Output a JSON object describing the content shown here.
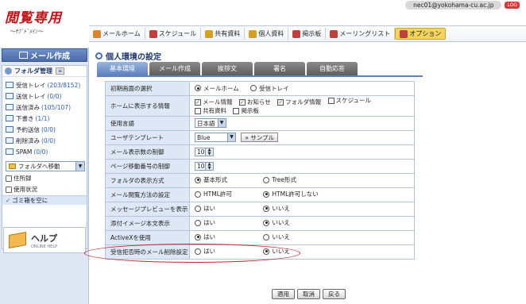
{
  "header": {
    "logo_main": "閲覧専用",
    "logo_sub": "〜ｻﾌﾞﾄﾞﾒｲﾝ〜",
    "user_email": "nec01@yokohama-cu.ac.jp",
    "logout_label": "LOG"
  },
  "nav": [
    {
      "label": "メールホーム",
      "icon": "home-icon",
      "color": "#e0832b"
    },
    {
      "label": "スケジュール",
      "icon": "calendar-icon",
      "color": "#c04040"
    },
    {
      "label": "共有資料",
      "icon": "shared-docs-icon",
      "color": "#d6a020"
    },
    {
      "label": "個人資料",
      "icon": "personal-docs-icon",
      "color": "#d6a020"
    },
    {
      "label": "掲示板",
      "icon": "board-icon",
      "color": "#c04040"
    },
    {
      "label": "メーリングリスト",
      "icon": "mailing-list-icon",
      "color": "#c04040"
    },
    {
      "label": "オプション",
      "icon": "option-icon",
      "color": "#c04040"
    }
  ],
  "sidebar": {
    "compose_label": "メール作成",
    "folder_manage_label": "フォルダ管理",
    "folder_toggle": "≡",
    "folders": [
      {
        "name": "受信トレイ",
        "count": "(203/8152)"
      },
      {
        "name": "送信トレイ",
        "count": "(0/0)"
      },
      {
        "name": "送信済み",
        "count": "(105/107)"
      },
      {
        "name": "下書き",
        "count": "(1/1)"
      },
      {
        "name": "予約送信",
        "count": "(0/0)"
      },
      {
        "name": "削除済み",
        "count": "(0/0)"
      },
      {
        "name": "SPAM",
        "count": "(0/0)"
      }
    ],
    "folder_move_label": "フォルダへ移動",
    "address_book": "住所録",
    "usage": "使用状況",
    "empty_trash": "ゴミ箱を空に",
    "help_title": "ヘルプ",
    "help_sub": "ONLINE HELP"
  },
  "main": {
    "title": "個人環境の設定",
    "tabs": [
      "基本環境",
      "メール作成",
      "挨拶文",
      "署名",
      "自動応答"
    ],
    "rows": {
      "init_screen": {
        "label": "初期画面の選択",
        "opt1": "メールホーム",
        "opt2": "受信トレイ"
      },
      "home_info": {
        "label": "ホームに表示する情報",
        "c1": "メール情報",
        "c2": "お知らせ",
        "c3": "フォルダ情報",
        "c4": "スケジュール",
        "c5": "共有資料",
        "c6": "掲示板"
      },
      "language": {
        "label": "使用言語",
        "value": "日本語"
      },
      "template": {
        "label": "ユーザテンプレート",
        "value": "Blue",
        "sample": "» サンプル"
      },
      "mail_count": {
        "label": "メール表示数の制御",
        "value": "10"
      },
      "page_count": {
        "label": "ページ移動番号の制御",
        "value": "10"
      },
      "folder_display": {
        "label": "フォルダの表示方式",
        "opt1": "基本形式",
        "opt2": "Tree形式"
      },
      "mail_read": {
        "label": "メール閲覧方法の設定",
        "opt1": "HTML許可",
        "opt2": "HTML許可しない"
      },
      "preview": {
        "label": "メッセージプレビューを表示",
        "opt1": "はい",
        "opt2": "いいえ"
      },
      "attach_image": {
        "label": "添付イメージ本文表示",
        "opt1": "はい",
        "opt2": "いいえ"
      },
      "activex": {
        "label": "ActiveXを使用",
        "opt1": "はい",
        "opt2": "いいえ"
      },
      "reject_read": {
        "label": "受信拒否時のメール削除設定",
        "opt1": "はい",
        "opt2": "いいえ"
      }
    },
    "actions": {
      "apply": "適用",
      "cancel": "取消",
      "back": "戻る"
    }
  }
}
